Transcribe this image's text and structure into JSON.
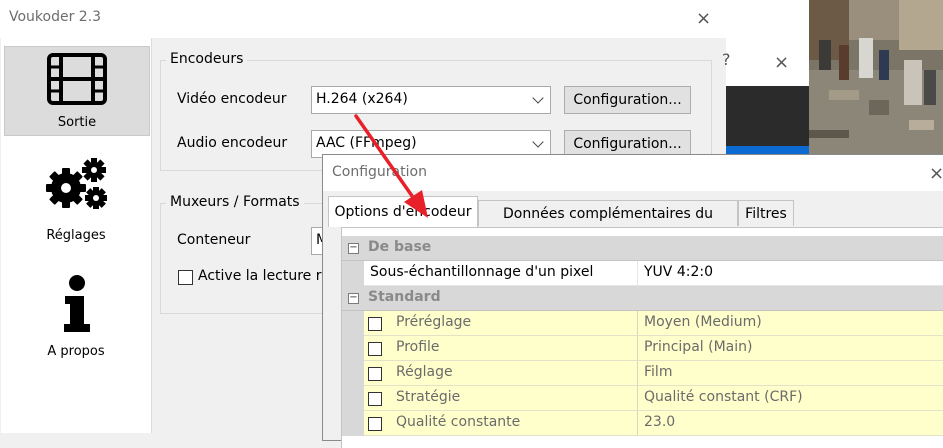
{
  "main_window": {
    "title": "Voukoder 2.3",
    "close_glyph": "×",
    "sidebar": {
      "items": [
        {
          "label": "Sortie",
          "icon": "film-strip-icon",
          "selected": true
        },
        {
          "label": "Réglages",
          "icon": "gears-icon",
          "selected": false
        },
        {
          "label": "A propos",
          "icon": "info-icon",
          "selected": false
        }
      ]
    },
    "encoders": {
      "group_label": "Encodeurs",
      "video_label": "Vidéo encodeur",
      "video_value": "H.264 (x264)",
      "audio_label": "Audio encodeur",
      "audio_value": "AAC (FFmpeg)",
      "config_button": "Configuration..."
    },
    "muxers": {
      "group_label": "Muxeurs / Formats",
      "container_label": "Conteneur",
      "container_value": "M",
      "fast_start_label": "Active la lecture rap"
    }
  },
  "background_window": {
    "help_glyph": "?",
    "close_glyph": "×"
  },
  "config_window": {
    "title": "Configuration",
    "close_glyph": "×",
    "tabs": [
      {
        "label": "Options d'encodeur",
        "active": true
      },
      {
        "label": "Données complémentaires du format",
        "active": false
      },
      {
        "label": "Filtres",
        "active": false
      }
    ],
    "categories": [
      {
        "label": "De base",
        "toggle": "−",
        "rows": [
          {
            "name": "Sous-échantillonnage d'un pixel",
            "value": "YUV 4:2:0",
            "checkbox": false
          }
        ]
      },
      {
        "label": "Standard",
        "toggle": "−",
        "rows": [
          {
            "name": "Préréglage",
            "value": "Moyen (Medium)",
            "checkbox": true
          },
          {
            "name": "Profile",
            "value": "Principal (Main)",
            "checkbox": true
          },
          {
            "name": "Réglage",
            "value": "Film",
            "checkbox": true
          },
          {
            "name": "Stratégie",
            "value": "Qualité constant (CRF)",
            "checkbox": true
          },
          {
            "name": "Qualité constante",
            "value": "23.0",
            "checkbox": true
          }
        ]
      }
    ]
  },
  "colors": {
    "arrow": "#e8202a",
    "highlight_row": "#ffffcc",
    "accent_blue": "#0c6bd3"
  }
}
